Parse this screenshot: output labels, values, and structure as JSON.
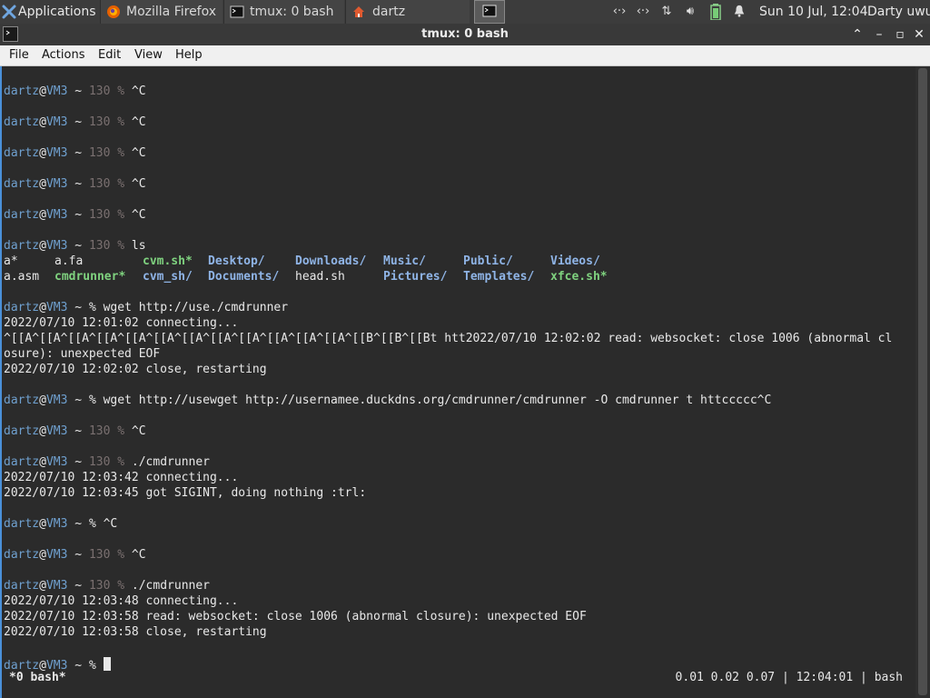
{
  "panel": {
    "applications_label": "Applications",
    "tasks": [
      {
        "label": "Mozilla Firefox",
        "icon": "firefox-icon"
      },
      {
        "label": "tmux: 0 bash",
        "icon": "terminal-icon"
      },
      {
        "label": "dartz",
        "icon": "home-folder-icon"
      }
    ],
    "clock": "Sun 10 Jul, 12:04",
    "user": "Darty uwu"
  },
  "window": {
    "title": "tmux: 0 bash",
    "menu": [
      "File",
      "Actions",
      "Edit",
      "View",
      "Help"
    ]
  },
  "terminal": {
    "prompt_user": "dartz",
    "prompt_host": "VM3",
    "lines": [
      {
        "kind": "prompt",
        "code": "130",
        "cmd": "^C"
      },
      {
        "kind": "blank"
      },
      {
        "kind": "prompt",
        "code": "130",
        "cmd": "^C"
      },
      {
        "kind": "blank"
      },
      {
        "kind": "prompt",
        "code": "130",
        "cmd": "^C"
      },
      {
        "kind": "blank"
      },
      {
        "kind": "prompt",
        "code": "130",
        "cmd": "^C"
      },
      {
        "kind": "blank"
      },
      {
        "kind": "prompt",
        "code": "130",
        "cmd": "^C"
      },
      {
        "kind": "blank"
      },
      {
        "kind": "prompt",
        "code": "130",
        "cmd": "ls"
      },
      {
        "kind": "ls",
        "items": [
          {
            "t": "a*",
            "c": "plain"
          },
          {
            "t": "a.fa",
            "c": "plain"
          },
          {
            "t": "cvm.sh*",
            "c": "green"
          },
          {
            "t": "Desktop/",
            "c": "blue"
          },
          {
            "t": "Downloads/",
            "c": "blue"
          },
          {
            "t": "Music/",
            "c": "blue"
          },
          {
            "t": "Public/",
            "c": "blue"
          },
          {
            "t": "Videos/",
            "c": "blue"
          }
        ]
      },
      {
        "kind": "ls",
        "items": [
          {
            "t": "a.asm",
            "c": "plain"
          },
          {
            "t": "cmdrunner*",
            "c": "green"
          },
          {
            "t": "cvm_sh/",
            "c": "blue"
          },
          {
            "t": "Documents/",
            "c": "blue"
          },
          {
            "t": "head.sh",
            "c": "plain"
          },
          {
            "t": "Pictures/",
            "c": "blue"
          },
          {
            "t": "Templates/",
            "c": "blue"
          },
          {
            "t": "xfce.sh*",
            "c": "green"
          }
        ]
      },
      {
        "kind": "blank"
      },
      {
        "kind": "prompt",
        "code": "",
        "cmd": "wget http://use./cmdrunner"
      },
      {
        "kind": "text",
        "text": "2022/07/10 12:01:02 connecting..."
      },
      {
        "kind": "text",
        "text": "^[[A^[[A^[[A^[[A^[[A^[[A^[[A^[[A^[[A^[[A^[[A^[[A^[[B^[[B^[[Bt htt2022/07/10 12:02:02 read: websocket: close 1006 (abnormal cl"
      },
      {
        "kind": "text",
        "text": "osure): unexpected EOF"
      },
      {
        "kind": "text",
        "text": "2022/07/10 12:02:02 close, restarting"
      },
      {
        "kind": "blank"
      },
      {
        "kind": "prompt",
        "code": "",
        "cmd": "wget http://usewget http://usernamee.duckdns.org/cmdrunner/cmdrunner -O cmdrunner t httccccc^C"
      },
      {
        "kind": "blank"
      },
      {
        "kind": "prompt",
        "code": "130",
        "cmd": "^C"
      },
      {
        "kind": "blank"
      },
      {
        "kind": "prompt",
        "code": "130",
        "cmd": "./cmdrunner"
      },
      {
        "kind": "text",
        "text": "2022/07/10 12:03:42 connecting..."
      },
      {
        "kind": "text",
        "text": "2022/07/10 12:03:45 got SIGINT, doing nothing :trl:"
      },
      {
        "kind": "blank"
      },
      {
        "kind": "prompt",
        "code": "",
        "cmd": "^C"
      },
      {
        "kind": "blank"
      },
      {
        "kind": "prompt",
        "code": "130",
        "cmd": "^C"
      },
      {
        "kind": "blank"
      },
      {
        "kind": "prompt",
        "code": "130",
        "cmd": "./cmdrunner"
      },
      {
        "kind": "text",
        "text": "2022/07/10 12:03:48 connecting..."
      },
      {
        "kind": "text",
        "text": "2022/07/10 12:03:58 read: websocket: close 1006 (abnormal closure): unexpected EOF"
      },
      {
        "kind": "text",
        "text": "2022/07/10 12:03:58 close, restarting"
      },
      {
        "kind": "blank"
      },
      {
        "kind": "prompt",
        "code": "",
        "cmd": "",
        "cursor": true
      }
    ]
  },
  "status": {
    "window": "*0 bash*",
    "right": "0.01 0.02 0.07 | 12:04:01 | bash"
  }
}
